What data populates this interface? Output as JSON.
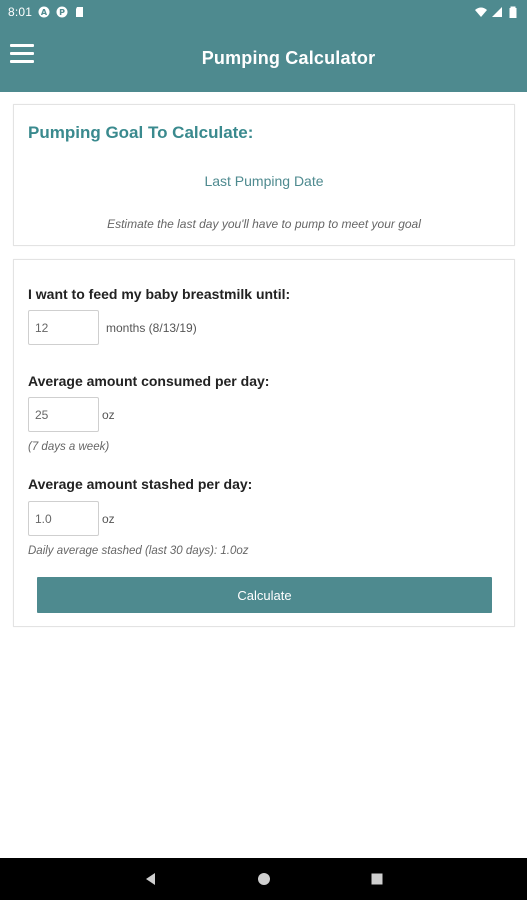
{
  "status_bar": {
    "time": "8:01",
    "icons_left": [
      "a-circle-icon",
      "p-circle-icon",
      "sd-card-icon"
    ],
    "icons_right": [
      "wifi-icon",
      "signal-icon",
      "battery-icon"
    ]
  },
  "app_bar": {
    "title": "Pumping Calculator",
    "menu_icon": "hamburger-menu-icon"
  },
  "goal_card": {
    "heading": "Pumping Goal To Calculate:",
    "selected_goal": "Last Pumping Date",
    "description": "Estimate the last day you'll have to pump to meet your goal"
  },
  "form": {
    "feed_until": {
      "label": "I want to feed my baby breastmilk until:",
      "value": "12",
      "unit": "months (8/13/19)"
    },
    "consumed": {
      "label": "Average amount consumed per day:",
      "value": "25",
      "unit": "oz",
      "note": "(7 days a week)"
    },
    "stashed": {
      "label": "Average amount stashed per day:",
      "value": "1.0",
      "unit": "oz",
      "note": "Daily average stashed (last 30 days): 1.0oz"
    },
    "calculate_label": "Calculate"
  },
  "nav_bar": {
    "icons": [
      "back-icon",
      "home-icon",
      "recents-icon"
    ]
  },
  "colors": {
    "primary": "#4e8a8f",
    "heading_teal": "#3a8a8e",
    "nav_bar": "#000000",
    "background": "#ffffff"
  }
}
